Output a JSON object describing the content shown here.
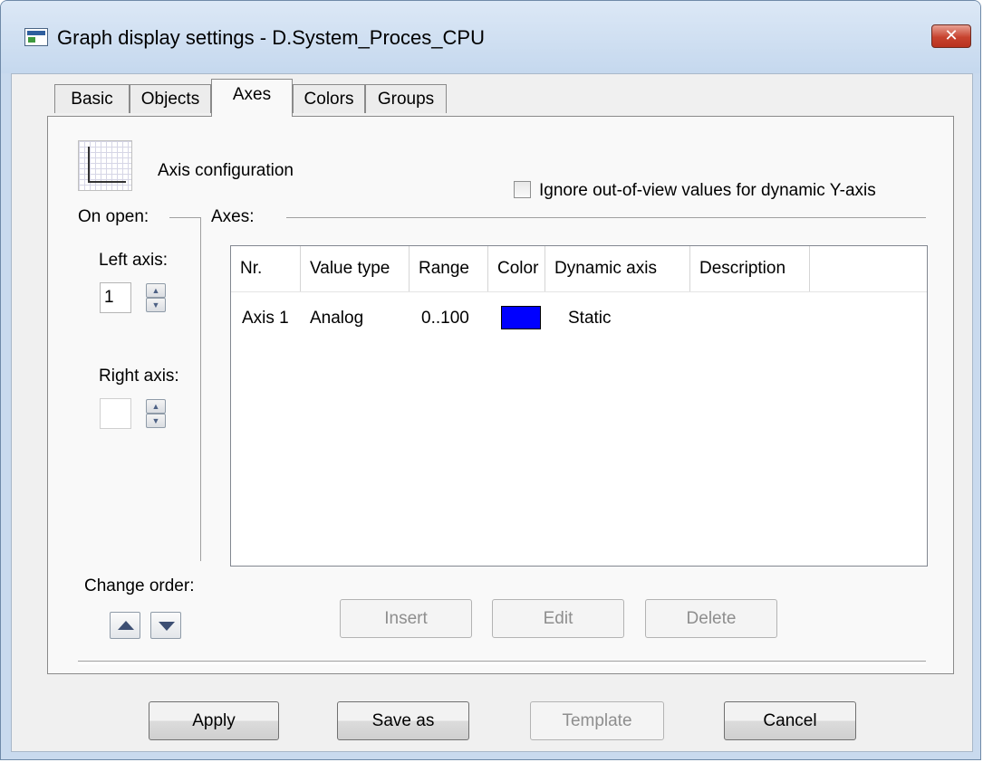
{
  "window": {
    "title": "Graph display settings - D.System_Proces_CPU",
    "close_glyph": "✕"
  },
  "tabs": [
    {
      "label": "Basic"
    },
    {
      "label": "Objects"
    },
    {
      "label": "Axes"
    },
    {
      "label": "Colors"
    },
    {
      "label": "Groups"
    }
  ],
  "active_tab": "Axes",
  "section": {
    "title": "Axis configuration",
    "icon": "axis-grid-icon"
  },
  "ignore_checkbox": {
    "label": "Ignore out-of-view values for dynamic Y-axis",
    "checked": false
  },
  "on_open": {
    "label": "On open:",
    "left_axis_label": "Left axis:",
    "left_axis_value": "1",
    "right_axis_label": "Right axis:",
    "right_axis_value": ""
  },
  "axes_group": {
    "label": "Axes:"
  },
  "table": {
    "columns": [
      "Nr.",
      "Value type",
      "Range",
      "Color",
      "Dynamic axis",
      "Description"
    ],
    "rows": [
      {
        "nr": "Axis 1",
        "value_type": "Analog",
        "range": "0..100",
        "color": "#0000ff",
        "dynamic_axis": "Static",
        "description": ""
      }
    ]
  },
  "change_order": {
    "label": "Change order:"
  },
  "axis_buttons": {
    "insert": "Insert",
    "edit": "Edit",
    "delete": "Delete"
  },
  "footer_buttons": {
    "apply": "Apply",
    "save_as": "Save as",
    "template": "Template",
    "cancel": "Cancel"
  }
}
